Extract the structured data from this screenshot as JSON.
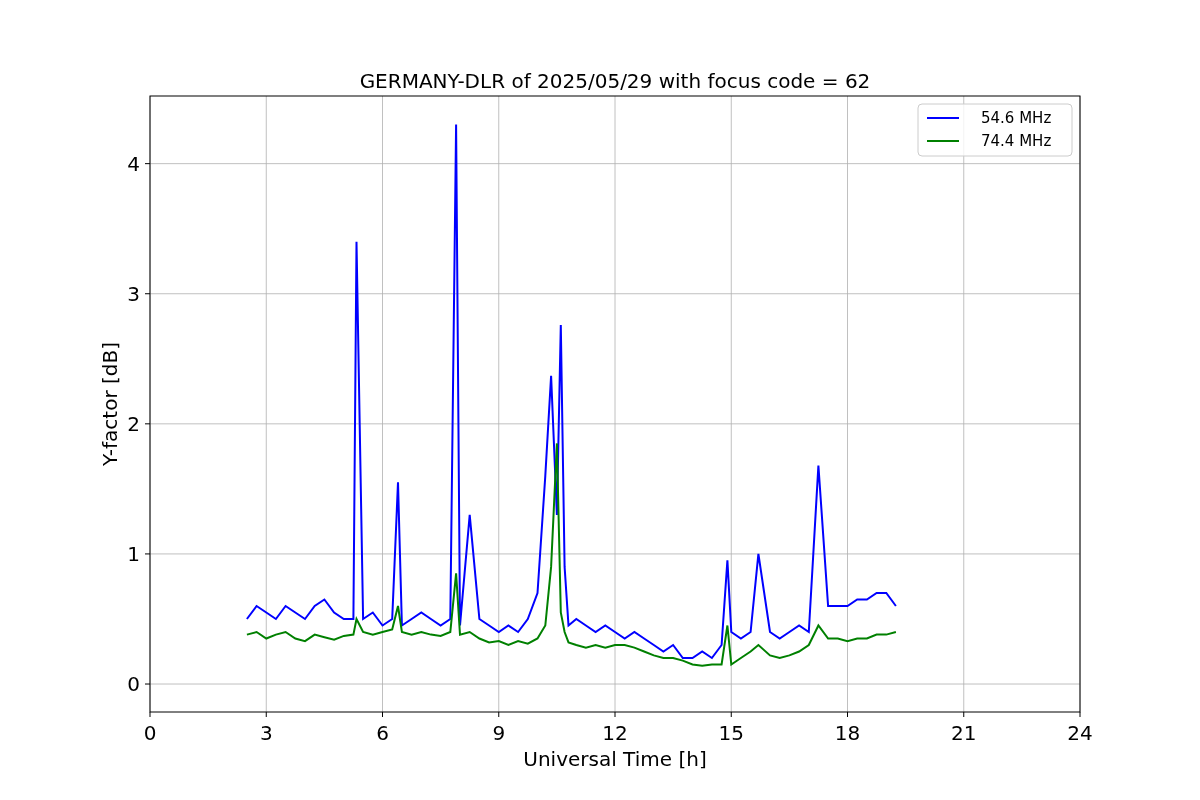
{
  "figure": {
    "chart_data": {
      "type": "line",
      "title": "GERMANY-DLR of 2025/05/29 with focus code = 62",
      "xlabel": "Universal Time [h]",
      "ylabel": "Y-factor [dB]",
      "xlim": [
        0,
        24
      ],
      "ylim": [
        -0.215,
        4.52
      ],
      "xticks": [
        0,
        3,
        6,
        9,
        12,
        15,
        18,
        21,
        24
      ],
      "yticks": [
        0,
        1,
        2,
        3,
        4
      ],
      "grid": true,
      "legend": true,
      "x": [
        2.5,
        2.75,
        3,
        3.25,
        3.5,
        3.75,
        4,
        4.25,
        4.5,
        4.75,
        5,
        5.25,
        5.33,
        5.5,
        5.75,
        6,
        6.25,
        6.4,
        6.5,
        6.75,
        7,
        7.25,
        7.5,
        7.75,
        7.9,
        8,
        8.25,
        8.5,
        8.75,
        9,
        9.25,
        9.5,
        9.75,
        10,
        10.2,
        10.35,
        10.5,
        10.6,
        10.7,
        10.8,
        11,
        11.25,
        11.5,
        11.75,
        12,
        12.25,
        12.5,
        12.75,
        13,
        13.25,
        13.5,
        13.75,
        14,
        14.25,
        14.5,
        14.75,
        14.9,
        15,
        15.25,
        15.5,
        15.7,
        16,
        16.25,
        16.5,
        16.75,
        17,
        17.25,
        17.5,
        17.75,
        18,
        18.25,
        18.5,
        18.75,
        19,
        19.25
      ],
      "series": [
        {
          "name": "54.6 MHz",
          "color": "#0000ff",
          "values": [
            0.5,
            0.6,
            0.55,
            0.5,
            0.6,
            0.55,
            0.5,
            0.6,
            0.65,
            0.55,
            0.5,
            0.5,
            3.4,
            0.5,
            0.55,
            0.45,
            0.5,
            1.55,
            0.45,
            0.5,
            0.55,
            0.5,
            0.45,
            0.5,
            4.3,
            0.45,
            1.3,
            0.5,
            0.45,
            0.4,
            0.45,
            0.4,
            0.5,
            0.7,
            1.6,
            2.37,
            1.3,
            2.76,
            0.9,
            0.45,
            0.5,
            0.45,
            0.4,
            0.45,
            0.4,
            0.35,
            0.4,
            0.35,
            0.3,
            0.25,
            0.3,
            0.2,
            0.2,
            0.25,
            0.2,
            0.3,
            0.95,
            0.4,
            0.35,
            0.4,
            1.0,
            0.4,
            0.35,
            0.4,
            0.45,
            0.4,
            1.68,
            0.6,
            0.6,
            0.6,
            0.65,
            0.65,
            0.7,
            0.7,
            0.6
          ]
        },
        {
          "name": "74.4 MHz",
          "color": "#008000",
          "values": [
            0.38,
            0.4,
            0.35,
            0.38,
            0.4,
            0.35,
            0.33,
            0.38,
            0.36,
            0.34,
            0.37,
            0.38,
            0.5,
            0.4,
            0.38,
            0.4,
            0.42,
            0.6,
            0.4,
            0.38,
            0.4,
            0.38,
            0.37,
            0.4,
            0.85,
            0.38,
            0.4,
            0.35,
            0.32,
            0.33,
            0.3,
            0.33,
            0.31,
            0.35,
            0.45,
            0.9,
            1.85,
            0.55,
            0.4,
            0.32,
            0.3,
            0.28,
            0.3,
            0.28,
            0.3,
            0.3,
            0.28,
            0.25,
            0.22,
            0.2,
            0.2,
            0.18,
            0.15,
            0.14,
            0.15,
            0.15,
            0.45,
            0.15,
            0.2,
            0.25,
            0.3,
            0.22,
            0.2,
            0.22,
            0.25,
            0.3,
            0.45,
            0.35,
            0.35,
            0.33,
            0.35,
            0.35,
            0.38,
            0.38,
            0.4
          ]
        }
      ]
    }
  }
}
